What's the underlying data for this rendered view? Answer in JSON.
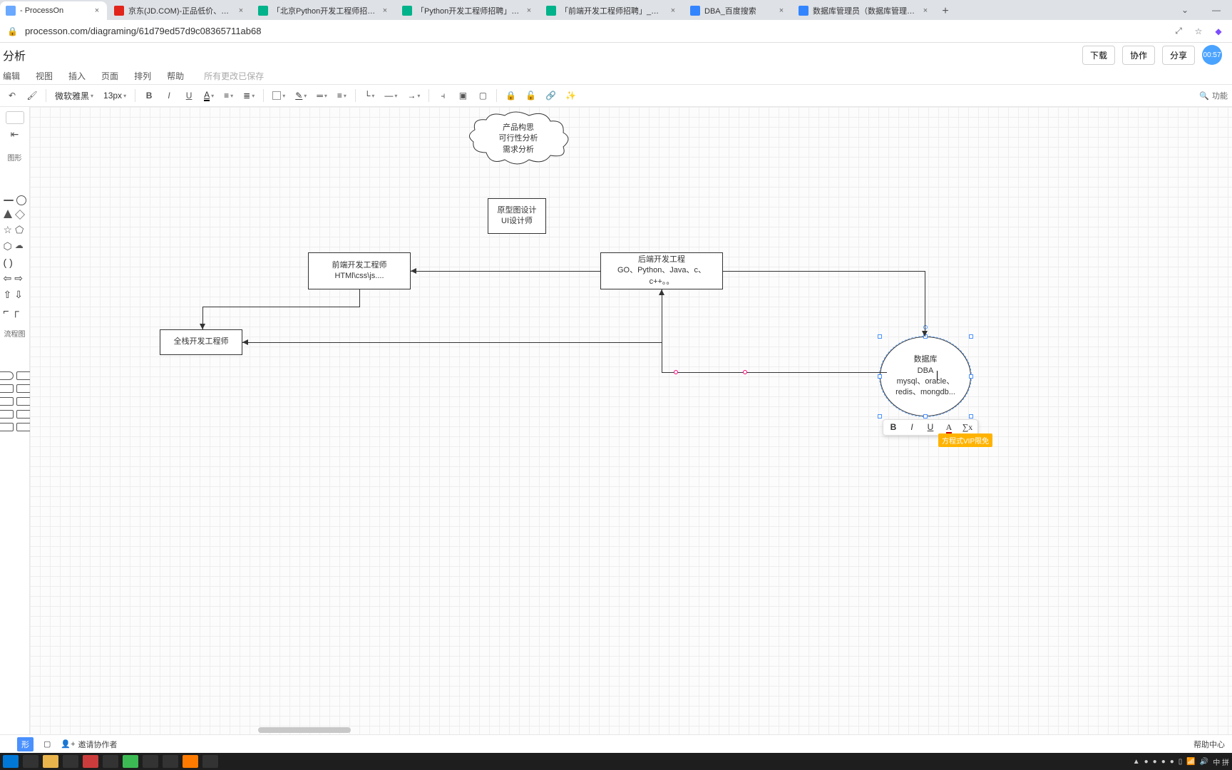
{
  "tabs": [
    {
      "title": "- ProcessOn",
      "favicon": "#6aa9ff"
    },
    {
      "title": "京东(JD.COM)-正品低价、品质…",
      "favicon": "#e1251b"
    },
    {
      "title": "「北京Python开发工程师招聘」…",
      "favicon": "#00b38a"
    },
    {
      "title": "「Python开发工程师招聘」_启…",
      "favicon": "#00b38a"
    },
    {
      "title": "「前端开发工程师招聘」_北京…",
      "favicon": "#00b38a"
    },
    {
      "title": "DBA_百度搜索",
      "favicon": "#3385ff"
    },
    {
      "title": "数据库管理员（数据库管理员）…",
      "favicon": "#3385ff"
    }
  ],
  "active_tab": 0,
  "url": "processon.com/diagraming/61d79ed57d9c08365711ab68",
  "page_title": "分析",
  "header_buttons": {
    "download": "下载",
    "collab": "协作",
    "share": "分享"
  },
  "avatar_text": "00:57",
  "menu": {
    "edit": "编辑",
    "view": "视图",
    "insert": "插入",
    "page": "页面",
    "arrange": "排列",
    "help": "帮助",
    "save_status": "所有更改已保存"
  },
  "toolbar": {
    "font": "微软雅黑",
    "fontsize": "13px",
    "search_label": "功能"
  },
  "left_panel": {
    "shapes_label": "图形",
    "flow_label": "流程图"
  },
  "diagram": {
    "cloud": {
      "l1": "产品构思",
      "l2": "可行性分析",
      "l3": "需求分析"
    },
    "proto": {
      "l1": "原型图设计",
      "l2": "UI设计师"
    },
    "frontend": {
      "l1": "前端开发工程师",
      "l2": "HTMl\\css\\js...."
    },
    "backend": {
      "l1": "后端开发工程",
      "l2": "GO、Python、Java、c、",
      "l3": "c++。。"
    },
    "fullstack": "全栈开发工程师",
    "db": {
      "l1": "数据库",
      "l2": "DBA",
      "l3": "mysql、oracle、",
      "l4": "redis、mongdb..."
    }
  },
  "selection_toolbar": {
    "b": "B",
    "i": "I",
    "u": "U",
    "a": "A",
    "fx": "∑x"
  },
  "vip_tooltip": "方程式VIP限免",
  "bottom": {
    "invite": "邀请协作者",
    "help": "帮助中心"
  },
  "tray": {
    "ime": "中 拼"
  }
}
